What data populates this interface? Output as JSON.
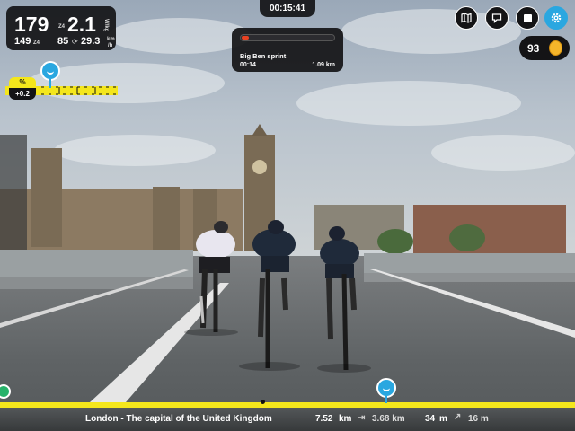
{
  "stats": {
    "power": "179",
    "zone": "Z4",
    "wkg": "2.1",
    "wkg_unit": "W/kg",
    "heart_rate": "149",
    "hr_zone": "Z4",
    "cadence": "85",
    "speed": "29.3",
    "speed_unit_top": "km",
    "speed_unit_bottom": "/h"
  },
  "timer": "00:15:41",
  "sprint": {
    "name": "Big Ben sprint",
    "time": "00:14",
    "distance": "1.09 km",
    "progress": 0.08
  },
  "gradient": {
    "label": "%",
    "value": "+0.2"
  },
  "coins": "93",
  "footer": {
    "location": "London - The capital of the United Kingdom",
    "distance": "7.52",
    "distance_unit": "km",
    "remaining": "3.68 km",
    "elevation": "34",
    "elevation_unit": "m",
    "climb": "16 m"
  },
  "colors": {
    "accent_yellow": "#f4e61c",
    "accent_blue": "#2aa7e0",
    "sprint_red": "#e84222",
    "coin_gold": "#f5b52a"
  },
  "icons": [
    "map-icon",
    "chat-icon",
    "stop-icon",
    "settings-icon",
    "coin-icon",
    "avatar-pin-icon"
  ]
}
